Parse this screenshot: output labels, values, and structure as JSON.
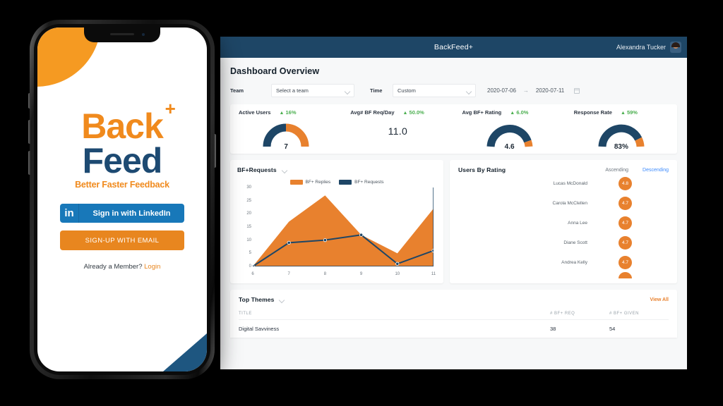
{
  "dashboard": {
    "app_title": "BackFeed+",
    "user_name": "Alexandra Tucker",
    "page_title": "Dashboard Overview",
    "filters": {
      "team_label": "Team",
      "team_value": "Select a team",
      "time_label": "Time",
      "time_value": "Custom",
      "date_start": "2020-07-06",
      "date_arrow": "→",
      "date_end": "2020-07-11"
    },
    "kpis": [
      {
        "label": "Active Users",
        "delta": "16%",
        "value": "7",
        "type": "gauge",
        "pct": 52
      },
      {
        "label": "Avg# BF Req/Day",
        "delta": "50.0%",
        "value": "11.0",
        "type": "number"
      },
      {
        "label": "Avg BF+ Rating",
        "delta": "6.0%",
        "value": "4.6",
        "type": "gauge",
        "pct": 92
      },
      {
        "label": "Response Rate",
        "delta": "59%",
        "value": "83%",
        "type": "gauge",
        "pct": 83
      }
    ],
    "chart_card": {
      "title": "BF+Requests"
    },
    "rating_card": {
      "title": "Users By Rating",
      "sort_ascending": "Ascending",
      "sort_descending": "Descending",
      "users": [
        {
          "name": "Lucas McDonald",
          "rating": "4.8"
        },
        {
          "name": "Carola McClellen",
          "rating": "4.7"
        },
        {
          "name": "Anna Lee",
          "rating": "4.7"
        },
        {
          "name": "Diane Scott",
          "rating": "4.7"
        },
        {
          "name": "Andrea Kelly",
          "rating": "4.7"
        }
      ]
    },
    "themes": {
      "title": "Top Themes",
      "view_all": "View All",
      "columns": [
        "TITLE",
        "# BF+ REQ",
        "# BF+ GIVEN"
      ],
      "rows": [
        {
          "title": "Digital Savviness",
          "req": "38",
          "given": "54"
        }
      ]
    },
    "colors": {
      "navy": "#1e4666",
      "orange": "#e8812e",
      "green": "#4caf50",
      "link_blue": "#3d8bfd"
    }
  },
  "phone": {
    "logo_top": "Back",
    "logo_plus": "+",
    "logo_bottom": "Feed",
    "tagline": "Better Faster Feedback",
    "linkedin_icon": "in",
    "linkedin_label": "Sign in with LinkedIn",
    "email_label": "SIGN-UP WITH EMAIL",
    "member_text": "Already a Member?",
    "login_label": "Login"
  },
  "chart_data": {
    "type": "area",
    "title": "BF+Requests",
    "xlabel": "",
    "ylabel": "",
    "x": [
      6,
      7,
      8,
      9,
      10,
      11
    ],
    "xticks": [
      "6",
      "7",
      "8",
      "9",
      "10",
      "11"
    ],
    "yticks": [
      "0",
      "5",
      "10",
      "15",
      "20",
      "25",
      "30"
    ],
    "ylim": [
      0,
      30
    ],
    "grid": false,
    "legend_position": "top-center",
    "series": [
      {
        "name": "BF+ Replies",
        "color": "#e8812e",
        "values": [
          0,
          17,
          27,
          12,
          5,
          22
        ]
      },
      {
        "name": "BF+ Requests",
        "color": "#1e4666",
        "values": [
          0,
          9,
          10,
          12,
          1,
          6
        ]
      }
    ]
  }
}
